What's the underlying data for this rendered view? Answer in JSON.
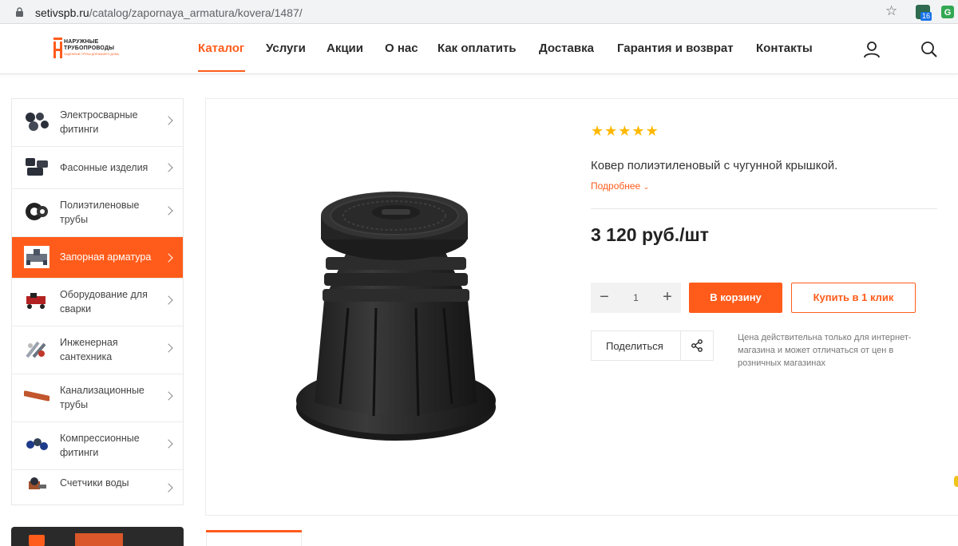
{
  "browser": {
    "url_host": "setivspb.ru",
    "url_path": "/catalog/zapornaya_armatura/kovera/1487/",
    "extension_badge": "16"
  },
  "header": {
    "logo_line1": "НАРУЖНЫЕ",
    "logo_line2": "ТРУБОПРОВОДЫ",
    "logo_tagline": "НАДЁЖНЫЕ ТРУБЫ ДЛЯ ВАШЕГО ДОМА",
    "nav": [
      {
        "label": "Каталог",
        "active": true
      },
      {
        "label": "Услуги"
      },
      {
        "label": "Акции"
      },
      {
        "label": "О нас"
      },
      {
        "label": "Как оплатить"
      },
      {
        "label": "Доставка"
      },
      {
        "label": "Гарантия и возврат"
      },
      {
        "label": "Контакты"
      }
    ],
    "icons": [
      "user-icon",
      "search-icon"
    ]
  },
  "sidebar": {
    "items": [
      {
        "label": "Электросварные фитинги",
        "icon": "electrofusion-fittings-thumb"
      },
      {
        "label": "Фасонные изделия",
        "icon": "shaped-products-thumb"
      },
      {
        "label": "Полиэтиленовые трубы",
        "icon": "pe-pipes-thumb"
      },
      {
        "label": "Запорная арматура",
        "icon": "shutoff-valves-thumb",
        "active": true
      },
      {
        "label": "Оборудование для сварки",
        "icon": "welding-equipment-thumb"
      },
      {
        "label": "Инженерная сантехника",
        "icon": "plumbing-thumb"
      },
      {
        "label": "Канализационные трубы",
        "icon": "sewer-pipes-thumb"
      },
      {
        "label": "Компрессионные фитинги",
        "icon": "compression-fittings-thumb"
      },
      {
        "label": "Счетчики воды",
        "icon": "water-meters-thumb"
      }
    ]
  },
  "product": {
    "rating": 5,
    "stars": [
      "★",
      "★",
      "★",
      "★",
      "★"
    ],
    "description": "Ковер полиэтиленовый с чугунной крышкой.",
    "more_label": "Подробнее",
    "price": "3 120 руб./шт",
    "quantity": "1",
    "qty_minus": "−",
    "qty_plus": "+",
    "add_to_cart": "В корзину",
    "buy_one_click": "Купить в 1 клик",
    "share_label": "Поделиться",
    "price_note": "Цена действительна только для интернет-магазина и может отличаться от цен в розничных магазинах"
  },
  "colors": {
    "accent": "#ff5c1b",
    "star": "#ffb800",
    "text": "#222222"
  }
}
